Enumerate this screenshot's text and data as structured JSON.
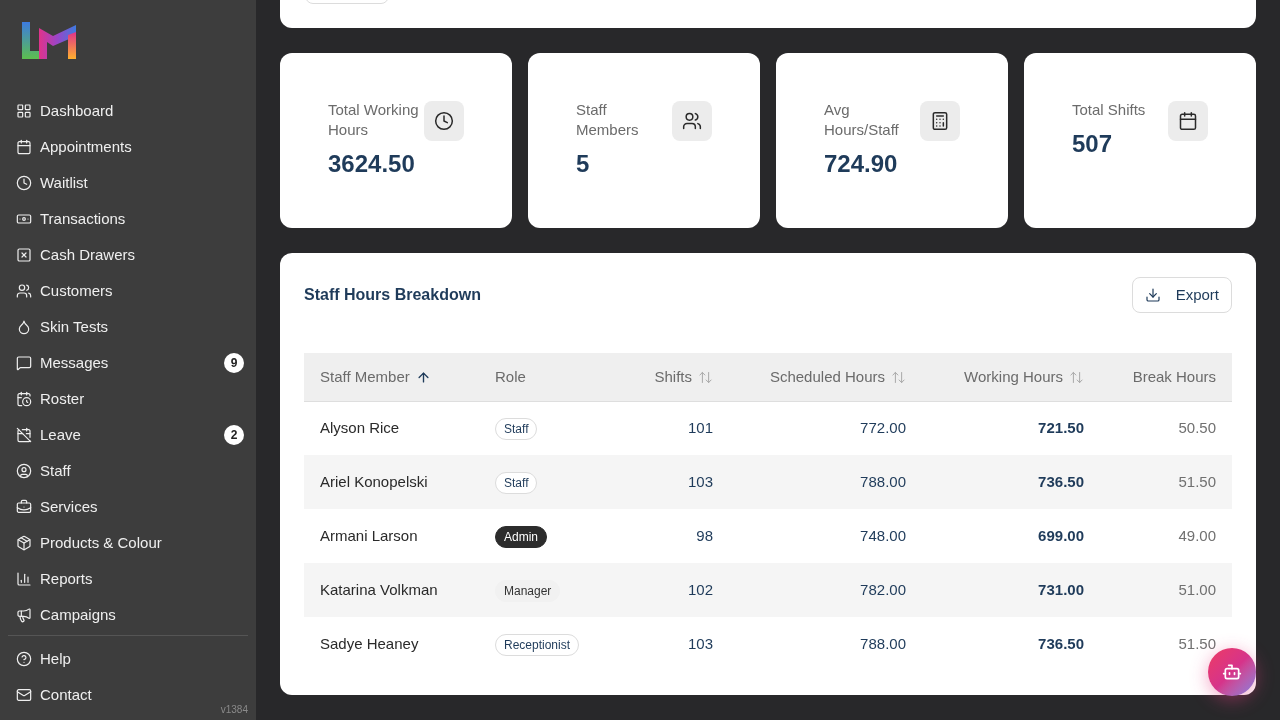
{
  "sidebar": {
    "nav_items": [
      {
        "label": "Dashboard"
      },
      {
        "label": "Appointments"
      },
      {
        "label": "Waitlist"
      },
      {
        "label": "Transactions"
      },
      {
        "label": "Cash Drawers"
      },
      {
        "label": "Customers"
      },
      {
        "label": "Skin Tests"
      },
      {
        "label": "Messages",
        "badge": "9"
      },
      {
        "label": "Roster"
      },
      {
        "label": "Leave",
        "badge": "2"
      },
      {
        "label": "Staff"
      },
      {
        "label": "Services"
      },
      {
        "label": "Products & Colour"
      },
      {
        "label": "Reports"
      },
      {
        "label": "Campaigns"
      }
    ],
    "footer_items": [
      {
        "label": "Help"
      },
      {
        "label": "Contact"
      }
    ],
    "version": "v1384"
  },
  "stats": [
    {
      "label": "Total Working Hours",
      "value": "3624.50"
    },
    {
      "label": "Staff Members",
      "value": "5"
    },
    {
      "label": "Avg Hours/Staff",
      "value": "724.90"
    },
    {
      "label": "Total Shifts",
      "value": "507"
    }
  ],
  "staff_hours": {
    "title": "Staff Hours Breakdown",
    "export_button": "Export",
    "columns": [
      {
        "label": "Staff Member",
        "sortable": true,
        "sorted": true
      },
      {
        "label": "Role",
        "sortable": false
      },
      {
        "label": "Shifts",
        "sortable": true,
        "sorted": false
      },
      {
        "label": "Scheduled Hours",
        "sortable": true,
        "sorted": false
      },
      {
        "label": "Working Hours",
        "sortable": true,
        "sorted": false
      },
      {
        "label": "Break Hours",
        "sortable": false
      }
    ],
    "rows": [
      {
        "name": "Alyson Rice",
        "role": {
          "label": "Staff",
          "kind": "outline"
        },
        "shifts": "101",
        "scheduled_hours": "772.00",
        "working_hours": "721.50",
        "break_hours": "50.50"
      },
      {
        "name": "Ariel Konopelski",
        "role": {
          "label": "Staff",
          "kind": "outline"
        },
        "shifts": "103",
        "scheduled_hours": "788.00",
        "working_hours": "736.50",
        "break_hours": "51.50"
      },
      {
        "name": "Armani Larson",
        "role": {
          "label": "Admin",
          "kind": "solid"
        },
        "shifts": "98",
        "scheduled_hours": "748.00",
        "working_hours": "699.00",
        "break_hours": "49.00"
      },
      {
        "name": "Katarina Volkman",
        "role": {
          "label": "Manager",
          "kind": "soft"
        },
        "shifts": "102",
        "scheduled_hours": "782.00",
        "working_hours": "731.00",
        "break_hours": "51.00"
      },
      {
        "name": "Sadye Heaney",
        "role": {
          "label": "Receptionist",
          "kind": "outline"
        },
        "shifts": "103",
        "scheduled_hours": "788.00",
        "working_hours": "736.50",
        "break_hours": "51.50"
      }
    ]
  }
}
